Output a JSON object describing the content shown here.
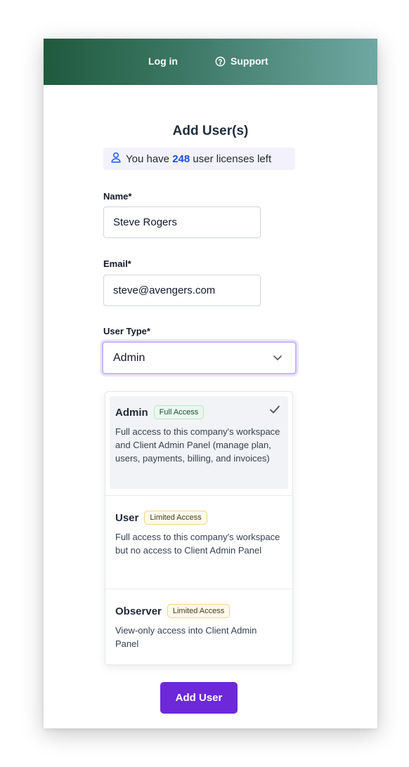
{
  "header": {
    "login_label": "Log in",
    "support_label": "Support"
  },
  "form": {
    "title": "Add User(s)",
    "license_prefix": "You have",
    "license_count": "248",
    "license_suffix": "user licenses left",
    "name_label": "Name*",
    "name_value": "Steve Rogers",
    "email_label": "Email*",
    "email_value": "steve@avengers.com",
    "user_type_label": "User Type*",
    "user_type_value": "Admin",
    "submit_label": "Add User"
  },
  "options": [
    {
      "name": "Admin",
      "badge": "Full Access",
      "description": "Full access to this company's workspace and Client Admin Panel (manage plan, users, payments, billing, and invoices)",
      "selected": true
    },
    {
      "name": "User",
      "badge": "Limited Access",
      "description": "Full access to this company's workspace but no access to Client Admin Panel",
      "selected": false
    },
    {
      "name": "Observer",
      "badge": "Limited Access",
      "description": "View-only access into Client Admin Panel",
      "selected": false
    }
  ],
  "colors": {
    "header_gradient_start": "#1f5a3e",
    "header_gradient_end": "#6fa8a2",
    "primary_button": "#6d28d9",
    "license_count": "#1d4ed8",
    "focus_border": "#c9b5f5"
  },
  "icons": [
    "support-icon",
    "user-icon",
    "chevron-down-icon",
    "check-icon"
  ]
}
